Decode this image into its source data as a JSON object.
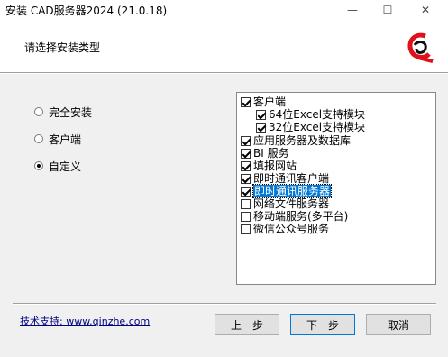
{
  "window": {
    "title": "安装 CAD服务器2024 (21.0.18)",
    "controls": [
      "—",
      "☐",
      "✕"
    ]
  },
  "header": {
    "title": "请选择安装类型",
    "logo_icon": "logo-icon"
  },
  "install_types": [
    {
      "label": "完全安装",
      "selected": false
    },
    {
      "label": "客户端",
      "selected": false
    },
    {
      "label": "自定义",
      "selected": true
    }
  ],
  "components": [
    {
      "label": "客户端",
      "checked": true,
      "indent": 0,
      "selected": false
    },
    {
      "label": "64位Excel支持模块",
      "checked": true,
      "indent": 1,
      "selected": false
    },
    {
      "label": "32位Excel支持模块",
      "checked": true,
      "indent": 1,
      "selected": false
    },
    {
      "label": "应用服务器及数据库",
      "checked": true,
      "indent": 0,
      "selected": false
    },
    {
      "label": "BI 服务",
      "checked": true,
      "indent": 0,
      "selected": false
    },
    {
      "label": "填报网站",
      "checked": true,
      "indent": 0,
      "selected": false
    },
    {
      "label": "即时通讯客户端",
      "checked": true,
      "indent": 0,
      "selected": false
    },
    {
      "label": "即时通讯服务器",
      "checked": true,
      "indent": 0,
      "selected": true
    },
    {
      "label": "网络文件服务器",
      "checked": false,
      "indent": 0,
      "selected": false
    },
    {
      "label": "移动端服务(多平台)",
      "checked": false,
      "indent": 0,
      "selected": false
    },
    {
      "label": "微信公众号服务",
      "checked": false,
      "indent": 0,
      "selected": false
    }
  ],
  "footer": {
    "support_link": "技术支持: www.qinzhe.com",
    "back_label": "上一步",
    "next_label": "下一步",
    "cancel_label": "取消"
  }
}
